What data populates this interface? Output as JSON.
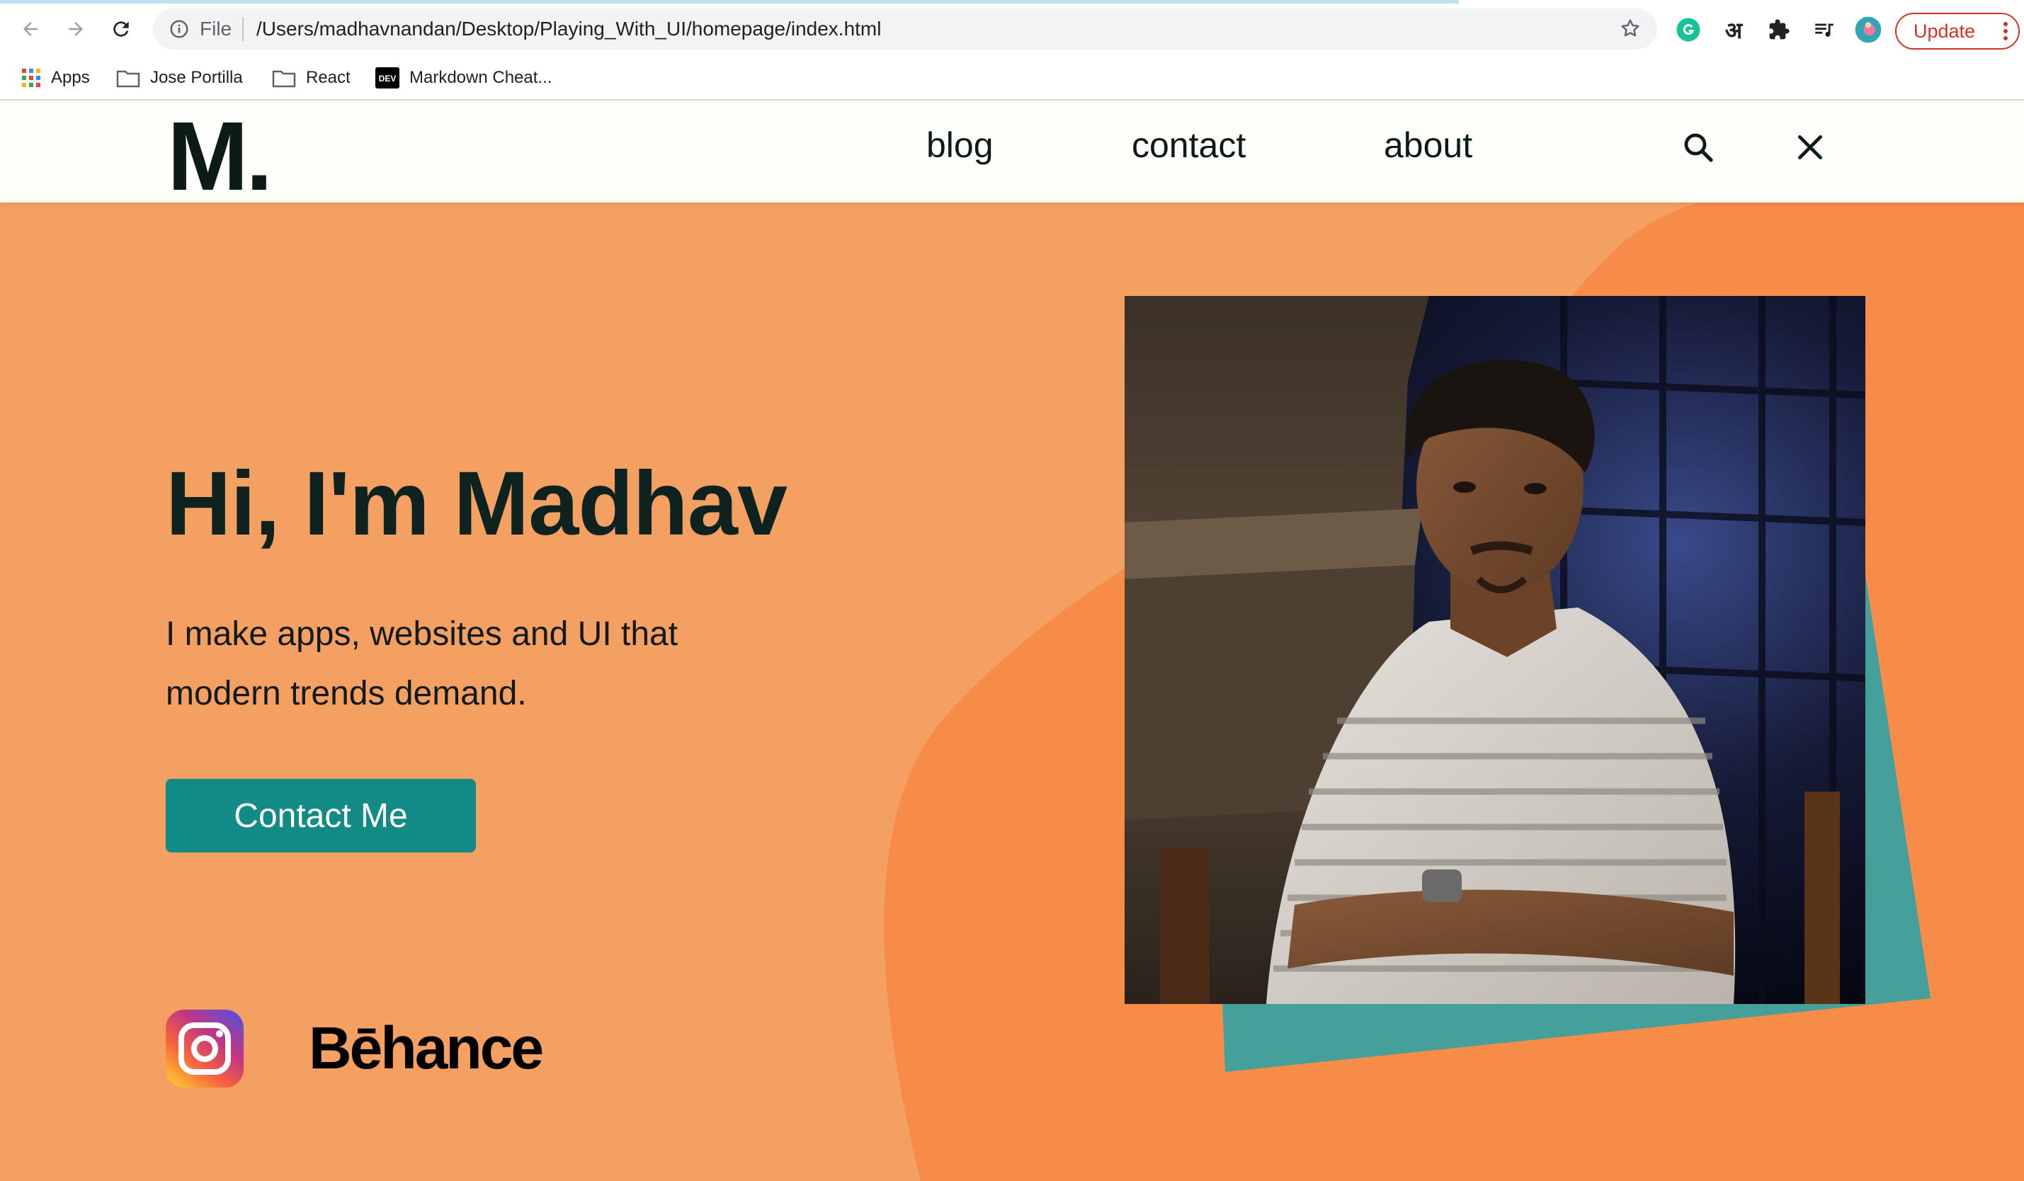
{
  "browser": {
    "url_scheme_label": "File",
    "url": "/Users/madhavnandan/Desktop/Playing_With_UI/homepage/index.html",
    "update_label": "Update",
    "extension_hindi_glyph": "अ",
    "bookmarks": [
      {
        "label": "Apps",
        "icon": "apps-grid-icon"
      },
      {
        "label": "Jose Portilla",
        "icon": "folder-icon"
      },
      {
        "label": "React",
        "icon": "folder-icon"
      },
      {
        "label": "Markdown Cheat...",
        "icon": "dev-logo-icon"
      }
    ]
  },
  "site": {
    "logo": "M.",
    "nav": [
      {
        "label": "blog"
      },
      {
        "label": "contact"
      },
      {
        "label": "about"
      }
    ],
    "search_icon": "search-icon",
    "close_icon": "close-icon"
  },
  "hero": {
    "headline": "Hi, I'm Madhav",
    "subline_1": "I make apps, websites and UI that",
    "subline_2": "modern trends demand.",
    "cta_label": "Contact Me",
    "social": {
      "instagram_icon": "instagram-icon",
      "behance_wordmark": "Bēhance"
    }
  },
  "colors": {
    "hero_bg": "#f4a062",
    "blob": "#f78c48",
    "teal_accent": "#45a09c",
    "cta_bg": "#128b87",
    "text_dark": "#0e2320",
    "header_bg": "#fdfef9",
    "update_red": "#d93025"
  }
}
